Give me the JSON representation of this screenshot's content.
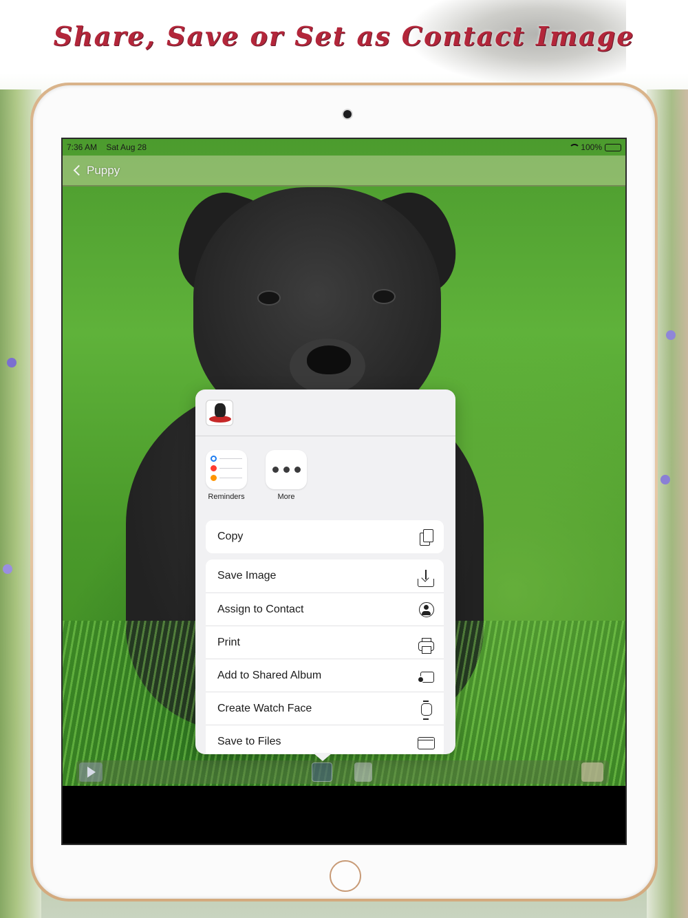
{
  "headline": "Share, Save or Set as Contact Image",
  "status_bar": {
    "time": "7:36 AM",
    "date": "Sat Aug 28",
    "battery": "100%"
  },
  "nav": {
    "back_label": "Puppy"
  },
  "share_sheet": {
    "apps": [
      {
        "label": "Reminders",
        "icon": "reminders-icon"
      },
      {
        "label": "More",
        "icon": "more-icon"
      }
    ],
    "primary_actions": [
      {
        "label": "Copy",
        "icon": "copy-icon"
      }
    ],
    "actions": [
      {
        "label": "Save Image",
        "icon": "save-image-icon"
      },
      {
        "label": "Assign to Contact",
        "icon": "contact-icon"
      },
      {
        "label": "Print",
        "icon": "print-icon"
      },
      {
        "label": "Add to Shared Album",
        "icon": "shared-album-icon"
      },
      {
        "label": "Create Watch Face",
        "icon": "watch-icon"
      },
      {
        "label": "Save to Files",
        "icon": "folder-icon"
      }
    ]
  },
  "toolbar": {
    "buttons": [
      "play-icon",
      "share-icon",
      "contact-card-icon",
      "tag-icon"
    ]
  },
  "colors": {
    "headline": "#b3263a",
    "frame": "#d9b38a",
    "sheet_bg": "#f1f1f3"
  }
}
